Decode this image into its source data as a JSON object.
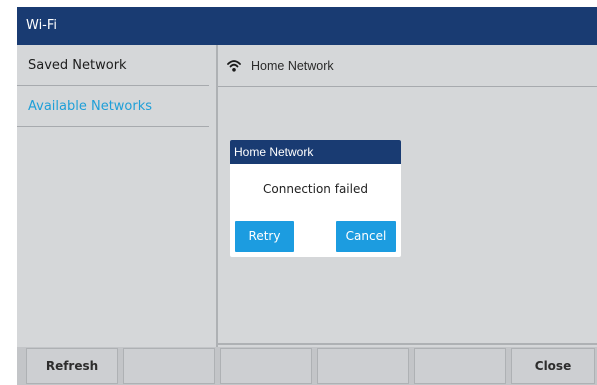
{
  "window": {
    "title": "Wi-Fi"
  },
  "sidebar": {
    "items": [
      {
        "label": "Saved Network",
        "selected": false
      },
      {
        "label": "Available Networks",
        "selected": true
      }
    ]
  },
  "main": {
    "networks": [
      {
        "name": "Home Network",
        "icon": "wifi-icon"
      }
    ]
  },
  "dialog": {
    "title": "Home Network",
    "message": "Connection failed",
    "retry_label": "Retry",
    "cancel_label": "Cancel"
  },
  "softkeys": [
    "Refresh",
    "",
    "",
    "",
    "",
    "Close"
  ],
  "colors": {
    "title_bar": "#193b72",
    "accent": "#1f9fd8",
    "button": "#1c9ce0",
    "background": "#d5d7d9"
  }
}
